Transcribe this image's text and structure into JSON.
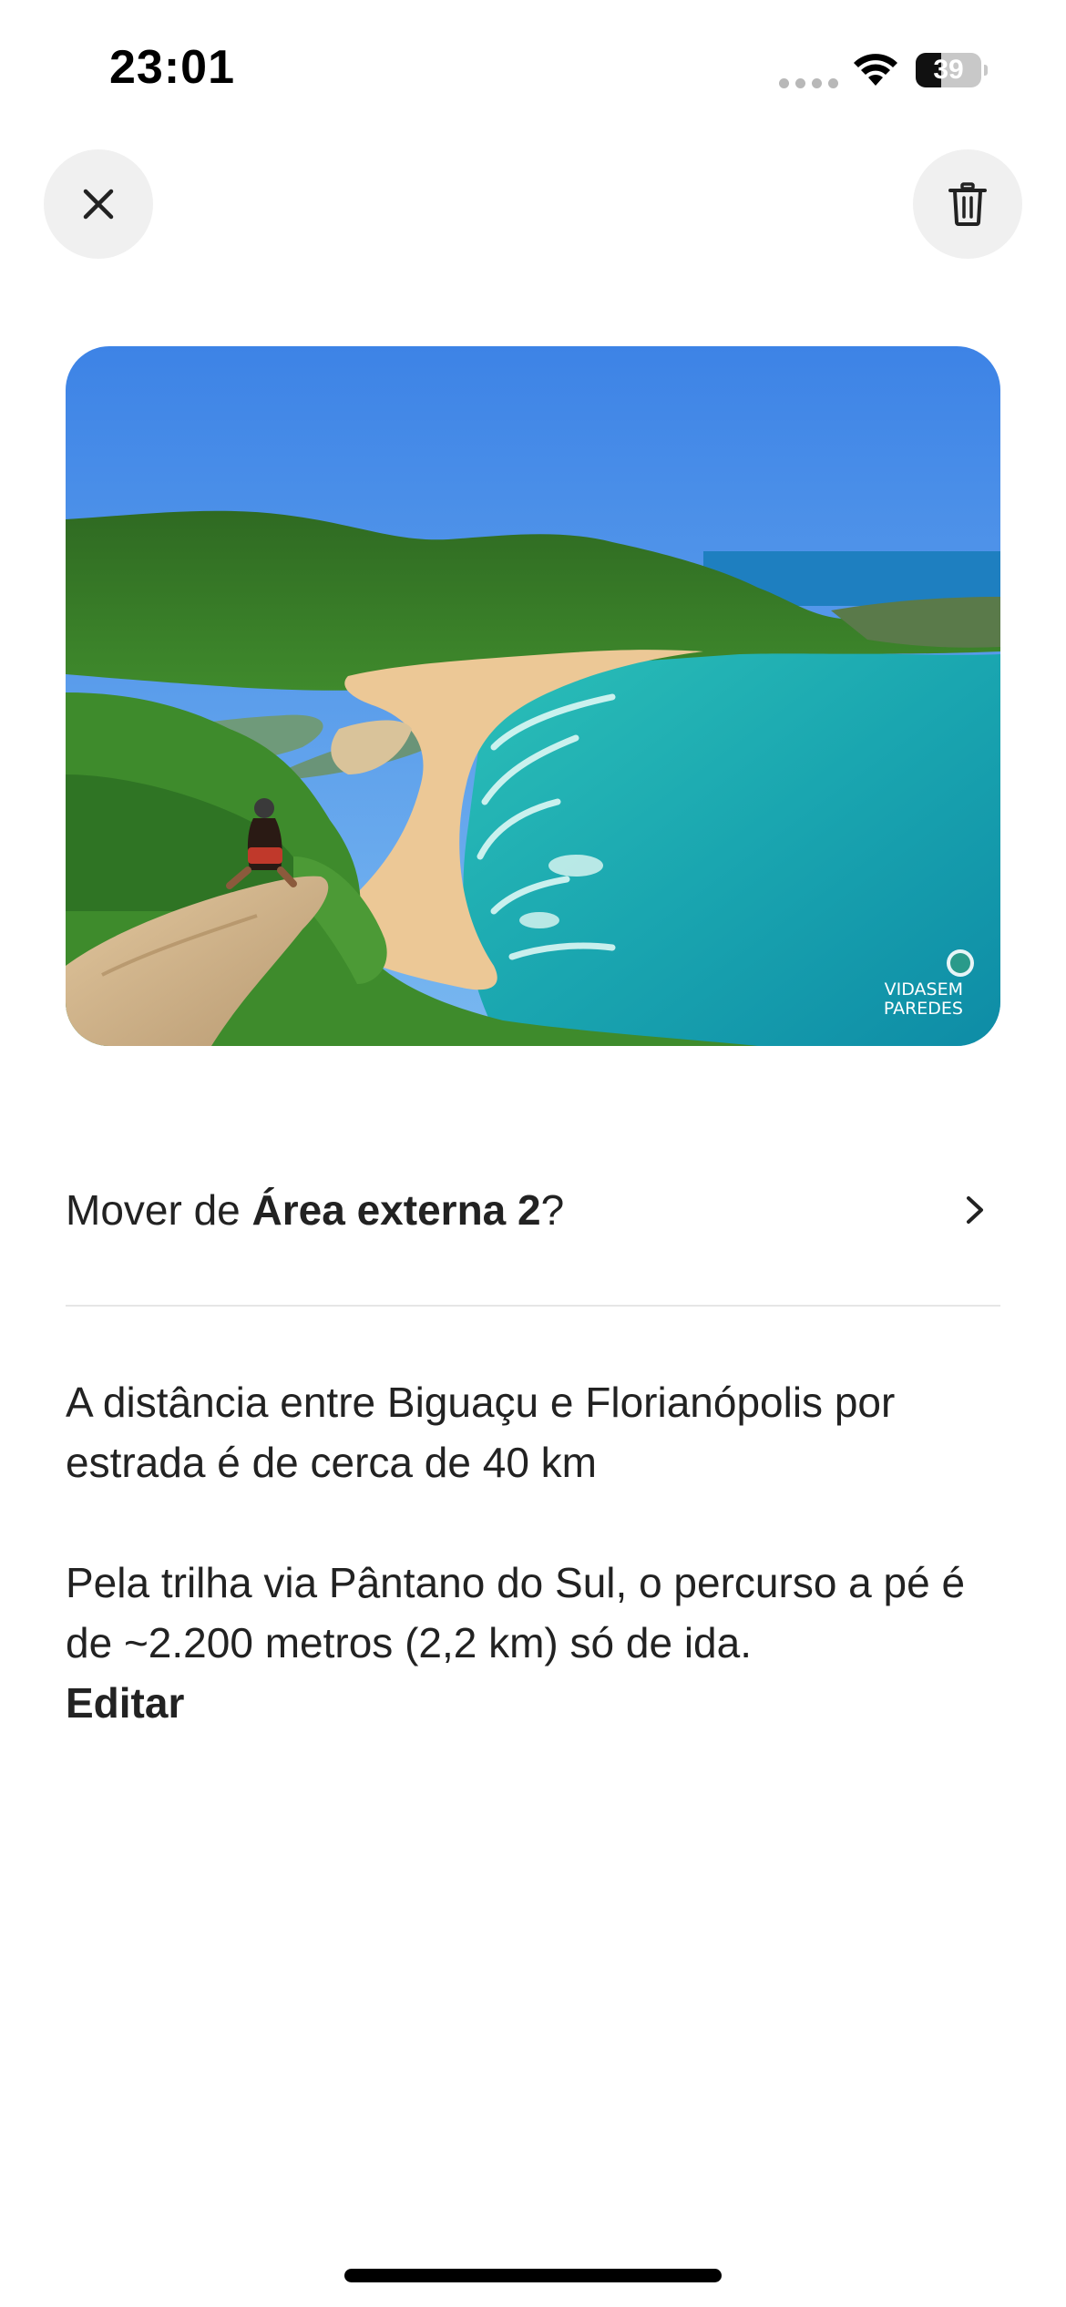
{
  "status_bar": {
    "time": "23:01",
    "battery_text": "39",
    "battery_level": 0.39,
    "wifi_icon": "wifi-icon",
    "signal_icon": "cellular-signal-icon"
  },
  "header": {
    "close_icon": "close-icon",
    "delete_icon": "trash-icon"
  },
  "photo": {
    "watermark_line1": "VIDASEM",
    "watermark_line2": "PAREDES"
  },
  "move": {
    "prefix": "Mover de ",
    "area_name": "Área externa 2",
    "suffix": "?",
    "chevron_icon": "chevron-right-icon"
  },
  "note": {
    "paragraph1": "A distância entre Biguaçu e Florianópolis por estrada é de cerca de 40 km",
    "paragraph2": "Pela trilha via Pântano do Sul, o percurso a pé é de ~2.200 metros (2,2 km) só de ida.",
    "edit_label": "Editar"
  },
  "colors": {
    "button_bg": "#f0f0f0",
    "text": "#222222",
    "divider": "#e6e6e6"
  }
}
